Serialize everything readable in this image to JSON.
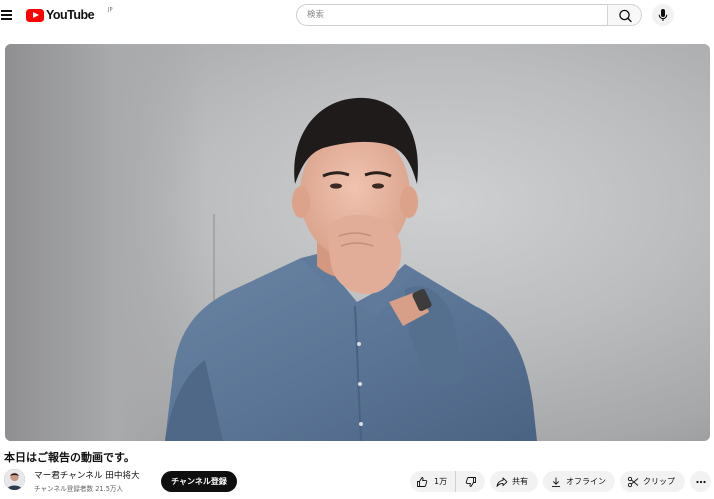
{
  "header": {
    "logo_text": "YouTube",
    "logo_region": "JP",
    "search_placeholder": "検索",
    "icons": [
      "menu-icon",
      "youtube-logo-icon",
      "search-icon",
      "mic-icon"
    ]
  },
  "video": {
    "title": "本日はご報告の動画です。"
  },
  "channel": {
    "name": "マー君チャンネル 田中将大",
    "subscribers": "チャンネル登録者数 21.5万人",
    "subscribe_label": "チャンネル登録"
  },
  "actions": {
    "like_count": "1万",
    "share_label": "共有",
    "offline_label": "オフライン",
    "clip_label": "クリップ",
    "icons": [
      "thumbs-up-icon",
      "thumbs-down-icon",
      "share-icon",
      "download-icon",
      "scissors-icon",
      "more-icon"
    ]
  },
  "colors": {
    "brand_red": "#ff0000",
    "subscribe_bg": "#0f0f0f",
    "pill_bg": "#f2f2f2",
    "shirt_blue": "#5d7898"
  }
}
